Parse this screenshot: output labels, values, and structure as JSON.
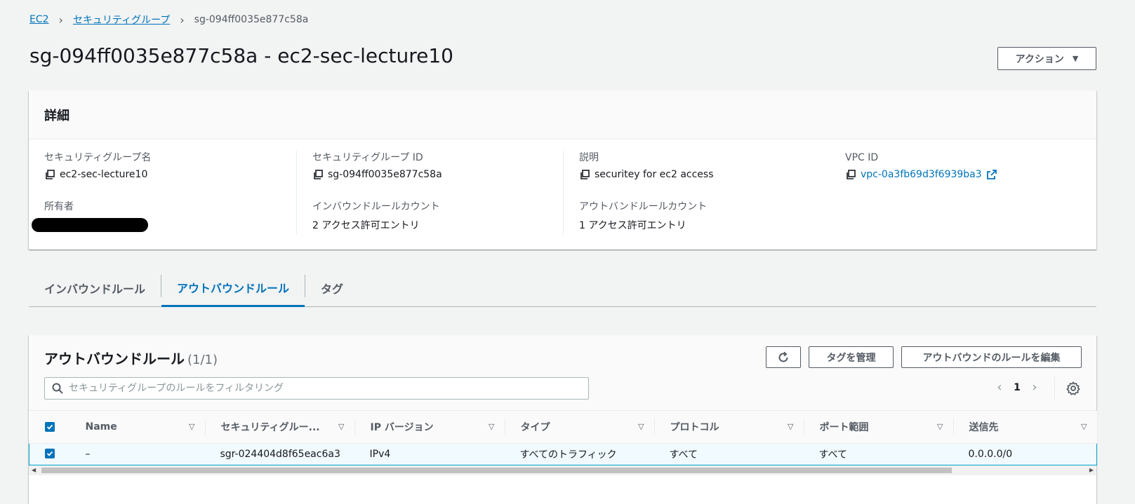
{
  "breadcrumb": {
    "items": [
      "EC2",
      "セキュリティグループ"
    ],
    "current": "sg-094ff0035e877c58a"
  },
  "page": {
    "title": "sg-094ff0035e877c58a - ec2-sec-lecture10",
    "actions_label": "アクション"
  },
  "details": {
    "header": "詳細",
    "fields": {
      "sg_name": {
        "label": "セキュリティグループ名",
        "value": "ec2-sec-lecture10"
      },
      "sg_id": {
        "label": "セキュリティグループ ID",
        "value": "sg-094ff0035e877c58a"
      },
      "description": {
        "label": "説明",
        "value": "securitey for ec2 access"
      },
      "vpc_id": {
        "label": "VPC ID",
        "value": "vpc-0a3fb69d3f6939ba3"
      },
      "owner": {
        "label": "所有者",
        "value": ""
      },
      "inbound_count": {
        "label": "インバウンドルールカウント",
        "value": "2 アクセス許可エントリ"
      },
      "outbound_count": {
        "label": "アウトバンドルールカウント",
        "value": "1 アクセス許可エントリ"
      }
    }
  },
  "tabs": [
    {
      "label": "インバウンドルール",
      "active": false
    },
    {
      "label": "アウトバウンドルール",
      "active": true
    },
    {
      "label": "タグ",
      "active": false
    }
  ],
  "rules_table": {
    "title": "アウトバウンドルール",
    "count": "(1/1)",
    "manage_tags_label": "タグを管理",
    "edit_rules_label": "アウトバウンドのルールを編集",
    "filter_placeholder": "セキュリティグループのルールをフィルタリング",
    "page_number": "1",
    "columns": [
      "Name",
      "セキュリティグルー...",
      "IP バージョン",
      "タイプ",
      "プロトコル",
      "ポート範囲",
      "送信先"
    ],
    "rows": [
      {
        "selected": true,
        "name": "–",
        "rule_id": "sgr-024404d8f65eac6a3",
        "ip_version": "IPv4",
        "type": "すべてのトラフィック",
        "protocol": "すべて",
        "port_range": "すべて",
        "destination": "0.0.0.0/0"
      }
    ]
  },
  "colors": {
    "link": "#0073bb",
    "selected_row_bg": "#f1faff",
    "selected_row_border": "#00a1c9"
  }
}
